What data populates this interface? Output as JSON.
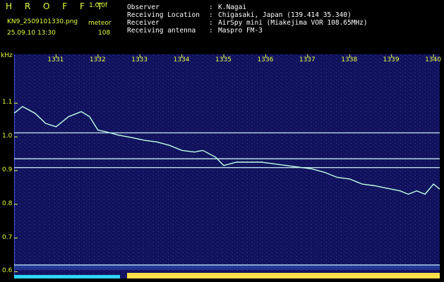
{
  "header": {
    "logo": "H R O F F T",
    "version": "1.0.0f",
    "filename": "KN9_2509101330.png",
    "mode": "meteor",
    "datetime": "25.09.10 13:30",
    "count": "108",
    "fields": [
      {
        "label": "Observer",
        "value": "K.Nagai"
      },
      {
        "label": "Receiving Location",
        "value": "Chigasaki, Japan (139.414 35.340)"
      },
      {
        "label": "Receiver",
        "value": "AirSpy mini (Miakejima VOR 108.65MHz)"
      },
      {
        "label": "Receiving antenna",
        "value": "Maspro FM-3"
      }
    ]
  },
  "plot": {
    "unit": "kHz",
    "ylim": [
      0.58,
      1.245
    ],
    "y_ticks": [
      "1.1",
      "1.0",
      "0.9",
      "0.8",
      "0.7",
      "0.6"
    ],
    "x_ticks": [
      "1331",
      "1332",
      "1333",
      "1334",
      "1335",
      "1336",
      "1337",
      "1338",
      "1339",
      "1340"
    ],
    "tone_lines_khz": [
      1.012,
      0.935,
      0.909,
      0.62
    ],
    "colors": {
      "background": "#11115a",
      "tone": "#d8ffff",
      "trace": "#bfffe4",
      "tick": "#e8ff3a",
      "meter_a": "#2fd6ff",
      "meter_b": "#ffe04a"
    }
  },
  "chart_data": {
    "type": "line",
    "title": "",
    "xlabel": "",
    "ylabel": "kHz",
    "ylim": [
      0.58,
      1.245
    ],
    "series": [
      {
        "x": [
          1330.0,
          1330.2,
          1330.5,
          1330.75,
          1331.0,
          1331.3,
          1331.6,
          1331.8,
          1332.0,
          1332.2,
          1332.5,
          1332.8,
          1333.1,
          1333.4,
          1333.7,
          1334.0,
          1334.3,
          1334.5,
          1334.8,
          1335.0,
          1335.3,
          1335.6,
          1335.9,
          1336.2,
          1336.5,
          1336.8,
          1337.1,
          1337.4,
          1337.7,
          1338.0,
          1338.3,
          1338.6,
          1338.8,
          1339.0,
          1339.2,
          1339.4,
          1339.6,
          1339.8,
          1340.0,
          1340.2
        ],
        "y": [
          1.07,
          1.09,
          1.07,
          1.04,
          1.03,
          1.06,
          1.075,
          1.06,
          1.02,
          1.015,
          1.005,
          0.998,
          0.99,
          0.985,
          0.975,
          0.96,
          0.955,
          0.96,
          0.94,
          0.915,
          0.925,
          0.925,
          0.925,
          0.92,
          0.915,
          0.91,
          0.905,
          0.895,
          0.88,
          0.875,
          0.86,
          0.855,
          0.85,
          0.845,
          0.84,
          0.83,
          0.84,
          0.83,
          0.86,
          0.845
        ]
      }
    ]
  }
}
